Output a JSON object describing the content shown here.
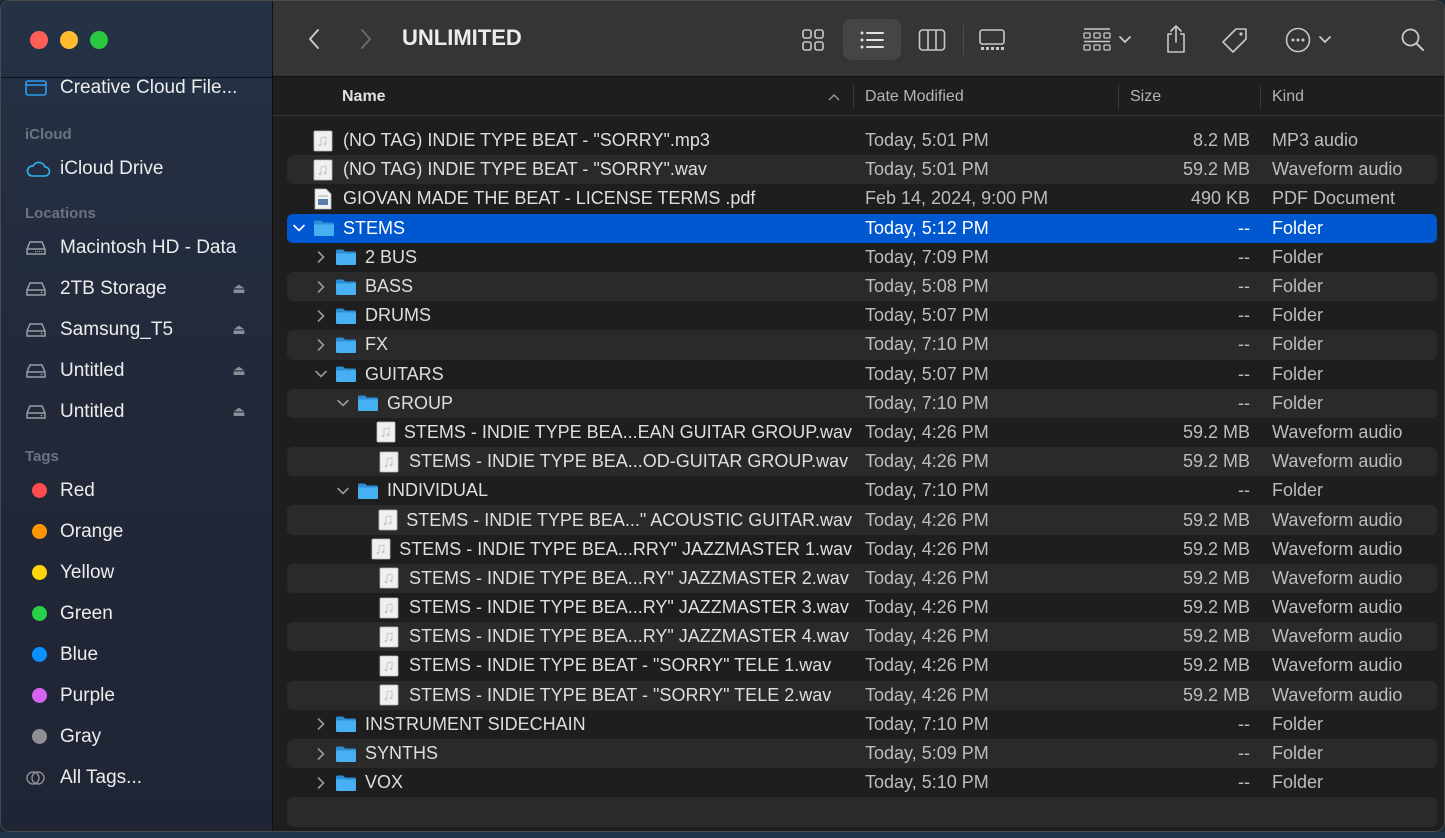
{
  "window": {
    "title": "UNLIMITED"
  },
  "colors": {
    "selection": "#0058d0",
    "folder": "#3fa9f5",
    "accent_icon": "#2f9bf0"
  },
  "sidebar": {
    "favorites": [
      {
        "label": "Creative Cloud File...",
        "icon": "creative-cloud-folder-icon"
      }
    ],
    "icloud_header": "iCloud",
    "icloud": [
      {
        "label": "iCloud Drive",
        "icon": "cloud-icon"
      }
    ],
    "locations_header": "Locations",
    "locations": [
      {
        "label": "Macintosh HD - Data",
        "icon": "internal-disk-icon",
        "eject": false
      },
      {
        "label": "2TB Storage",
        "icon": "external-disk-icon",
        "eject": true
      },
      {
        "label": "Samsung_T5",
        "icon": "external-disk-icon",
        "eject": true
      },
      {
        "label": "Untitled",
        "icon": "external-disk-icon",
        "eject": true
      },
      {
        "label": "Untitled",
        "icon": "external-disk-icon",
        "eject": true
      }
    ],
    "tags_header": "Tags",
    "tags": [
      {
        "label": "Red",
        "color": "#fe4b4b"
      },
      {
        "label": "Orange",
        "color": "#ff9500"
      },
      {
        "label": "Yellow",
        "color": "#ffd60a"
      },
      {
        "label": "Green",
        "color": "#27d14a"
      },
      {
        "label": "Blue",
        "color": "#0a91ff"
      },
      {
        "label": "Purple",
        "color": "#d663f0"
      },
      {
        "label": "Gray",
        "color": "#8e8e93"
      }
    ],
    "all_tags": "All Tags..."
  },
  "toolbar": {
    "back": "back",
    "forward": "forward",
    "views": [
      "icon-view",
      "list-view",
      "column-view",
      "gallery-view"
    ],
    "active_view": "list-view"
  },
  "columns": {
    "name": "Name",
    "date": "Date Modified",
    "size": "Size",
    "kind": "Kind",
    "sort": "ascending"
  },
  "rows": [
    {
      "name": "(NO TAG) INDIE TYPE BEAT - \"SORRY\".mp3",
      "date": "Today, 5:01 PM",
      "size": "8.2 MB",
      "kind": "MP3 audio",
      "type": "audio",
      "depth": 0,
      "disc": "none"
    },
    {
      "name": "(NO TAG) INDIE TYPE BEAT - \"SORRY\".wav",
      "date": "Today, 5:01 PM",
      "size": "59.2 MB",
      "kind": "Waveform audio",
      "type": "audio",
      "depth": 0,
      "disc": "none"
    },
    {
      "name": "GIOVAN MADE THE BEAT - LICENSE TERMS .pdf",
      "date": "Feb 14, 2024, 9:00 PM",
      "size": "490 KB",
      "kind": "PDF Document",
      "type": "pdf",
      "depth": 0,
      "disc": "none"
    },
    {
      "name": "STEMS",
      "date": "Today, 5:12 PM",
      "size": "--",
      "kind": "Folder",
      "type": "folder",
      "depth": 0,
      "disc": "open",
      "selected": true
    },
    {
      "name": "2 BUS",
      "date": "Today, 7:09 PM",
      "size": "--",
      "kind": "Folder",
      "type": "folder",
      "depth": 1,
      "disc": "closed"
    },
    {
      "name": "BASS",
      "date": "Today, 5:08 PM",
      "size": "--",
      "kind": "Folder",
      "type": "folder",
      "depth": 1,
      "disc": "closed"
    },
    {
      "name": "DRUMS",
      "date": "Today, 5:07 PM",
      "size": "--",
      "kind": "Folder",
      "type": "folder",
      "depth": 1,
      "disc": "closed"
    },
    {
      "name": "FX",
      "date": "Today, 7:10 PM",
      "size": "--",
      "kind": "Folder",
      "type": "folder",
      "depth": 1,
      "disc": "closed"
    },
    {
      "name": "GUITARS",
      "date": "Today, 5:07 PM",
      "size": "--",
      "kind": "Folder",
      "type": "folder",
      "depth": 1,
      "disc": "open"
    },
    {
      "name": "GROUP",
      "date": "Today, 7:10 PM",
      "size": "--",
      "kind": "Folder",
      "type": "folder",
      "depth": 2,
      "disc": "open"
    },
    {
      "name": "STEMS - INDIE TYPE BEA...EAN GUITAR GROUP.wav",
      "date": "Today, 4:26 PM",
      "size": "59.2 MB",
      "kind": "Waveform audio",
      "type": "audio",
      "depth": 3,
      "disc": "none"
    },
    {
      "name": "STEMS - INDIE TYPE BEA...OD-GUITAR GROUP.wav",
      "date": "Today, 4:26 PM",
      "size": "59.2 MB",
      "kind": "Waveform audio",
      "type": "audio",
      "depth": 3,
      "disc": "none"
    },
    {
      "name": "INDIVIDUAL",
      "date": "Today, 7:10 PM",
      "size": "--",
      "kind": "Folder",
      "type": "folder",
      "depth": 2,
      "disc": "open"
    },
    {
      "name": "STEMS - INDIE TYPE BEA...\" ACOUSTIC GUITAR.wav",
      "date": "Today, 4:26 PM",
      "size": "59.2 MB",
      "kind": "Waveform audio",
      "type": "audio",
      "depth": 3,
      "disc": "none"
    },
    {
      "name": "STEMS - INDIE TYPE BEA...RRY\" JAZZMASTER 1.wav",
      "date": "Today, 4:26 PM",
      "size": "59.2 MB",
      "kind": "Waveform audio",
      "type": "audio",
      "depth": 3,
      "disc": "none"
    },
    {
      "name": "STEMS - INDIE TYPE BEA...RY\" JAZZMASTER 2.wav",
      "date": "Today, 4:26 PM",
      "size": "59.2 MB",
      "kind": "Waveform audio",
      "type": "audio",
      "depth": 3,
      "disc": "none"
    },
    {
      "name": "STEMS - INDIE TYPE BEA...RY\" JAZZMASTER 3.wav",
      "date": "Today, 4:26 PM",
      "size": "59.2 MB",
      "kind": "Waveform audio",
      "type": "audio",
      "depth": 3,
      "disc": "none"
    },
    {
      "name": "STEMS - INDIE TYPE BEA...RY\" JAZZMASTER 4.wav",
      "date": "Today, 4:26 PM",
      "size": "59.2 MB",
      "kind": "Waveform audio",
      "type": "audio",
      "depth": 3,
      "disc": "none"
    },
    {
      "name": "STEMS - INDIE TYPE BEAT - \"SORRY\" TELE 1.wav",
      "date": "Today, 4:26 PM",
      "size": "59.2 MB",
      "kind": "Waveform audio",
      "type": "audio",
      "depth": 3,
      "disc": "none"
    },
    {
      "name": "STEMS - INDIE TYPE BEAT - \"SORRY\" TELE 2.wav",
      "date": "Today, 4:26 PM",
      "size": "59.2 MB",
      "kind": "Waveform audio",
      "type": "audio",
      "depth": 3,
      "disc": "none"
    },
    {
      "name": "INSTRUMENT SIDECHAIN",
      "date": "Today, 7:10 PM",
      "size": "--",
      "kind": "Folder",
      "type": "folder",
      "depth": 1,
      "disc": "closed"
    },
    {
      "name": "SYNTHS",
      "date": "Today, 5:09 PM",
      "size": "--",
      "kind": "Folder",
      "type": "folder",
      "depth": 1,
      "disc": "closed"
    },
    {
      "name": "VOX",
      "date": "Today, 5:10 PM",
      "size": "--",
      "kind": "Folder",
      "type": "folder",
      "depth": 1,
      "disc": "closed"
    }
  ]
}
